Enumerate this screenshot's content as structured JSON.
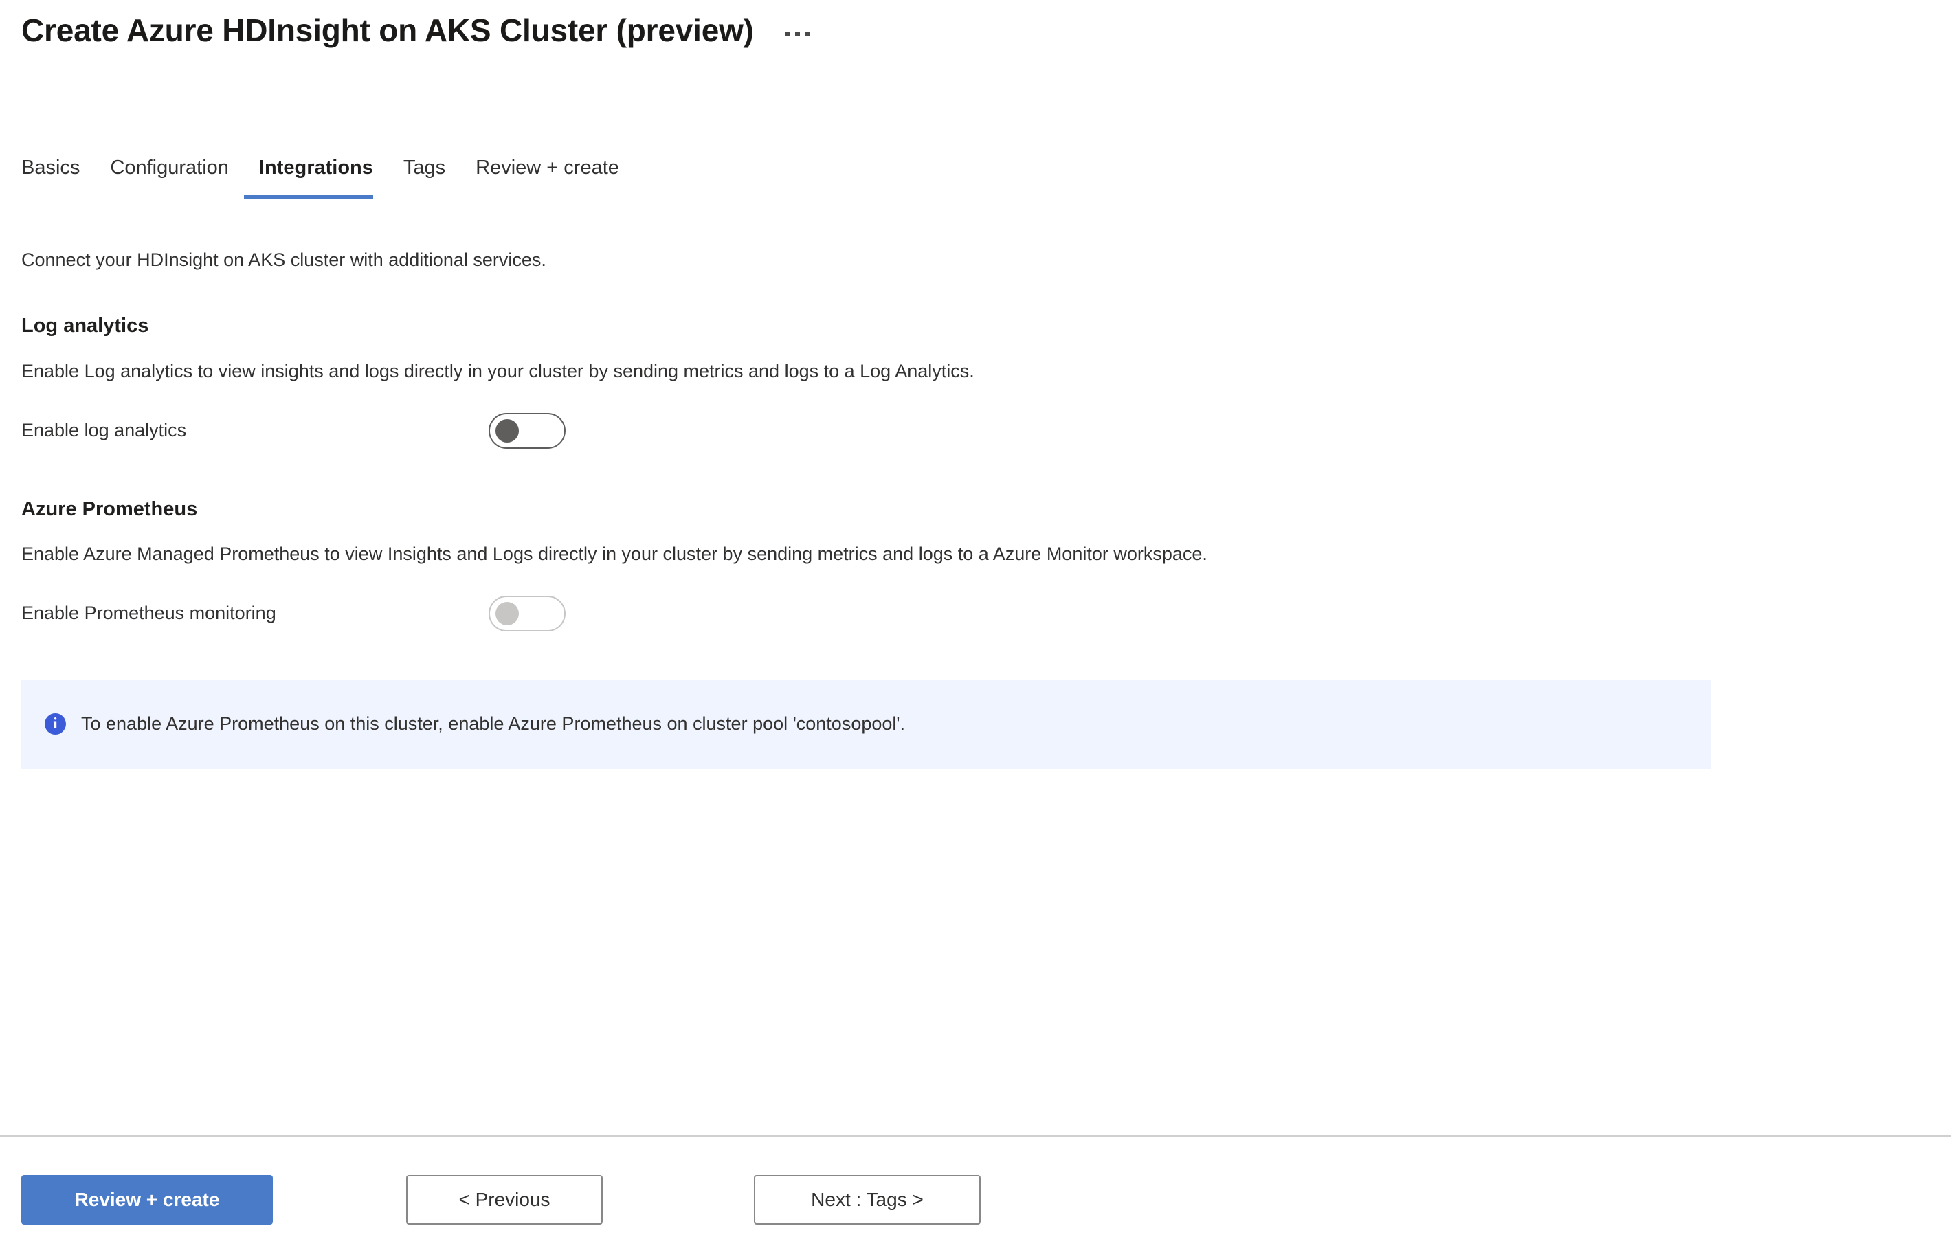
{
  "header": {
    "title": "Create Azure HDInsight on AKS Cluster (preview)",
    "more_actions_icon": "ellipsis-icon"
  },
  "tabs": [
    {
      "label": "Basics",
      "active": false
    },
    {
      "label": "Configuration",
      "active": false
    },
    {
      "label": "Integrations",
      "active": true
    },
    {
      "label": "Tags",
      "active": false
    },
    {
      "label": "Review + create",
      "active": false
    }
  ],
  "main": {
    "intro": "Connect your HDInsight on AKS cluster with additional services.",
    "sections": [
      {
        "title": "Log analytics",
        "description": "Enable Log analytics to view insights and logs directly in your cluster by sending metrics and logs to a Log Analytics.",
        "toggle": {
          "label": "Enable log analytics",
          "state": "off",
          "disabled": false
        }
      },
      {
        "title": "Azure Prometheus",
        "description": "Enable Azure Managed Prometheus to view Insights and Logs directly in your cluster by sending metrics and logs to a Azure Monitor workspace.",
        "toggle": {
          "label": "Enable Prometheus monitoring",
          "state": "off",
          "disabled": true
        }
      }
    ],
    "info_banner": {
      "icon": "info-circle-icon",
      "text": "To enable Azure Prometheus on this cluster, enable Azure Prometheus on cluster pool 'contosopool'."
    }
  },
  "footer": {
    "review_create_label": "Review + create",
    "previous_label": "< Previous",
    "next_label": "Next : Tags >"
  },
  "colors": {
    "accent": "#4a7bc8",
    "info_icon": "#3b5bd9",
    "info_banner_bg": "#eff4fe",
    "toggle_enabled": "#605e5c",
    "toggle_disabled": "#c8c6c4",
    "text": "#323130"
  }
}
